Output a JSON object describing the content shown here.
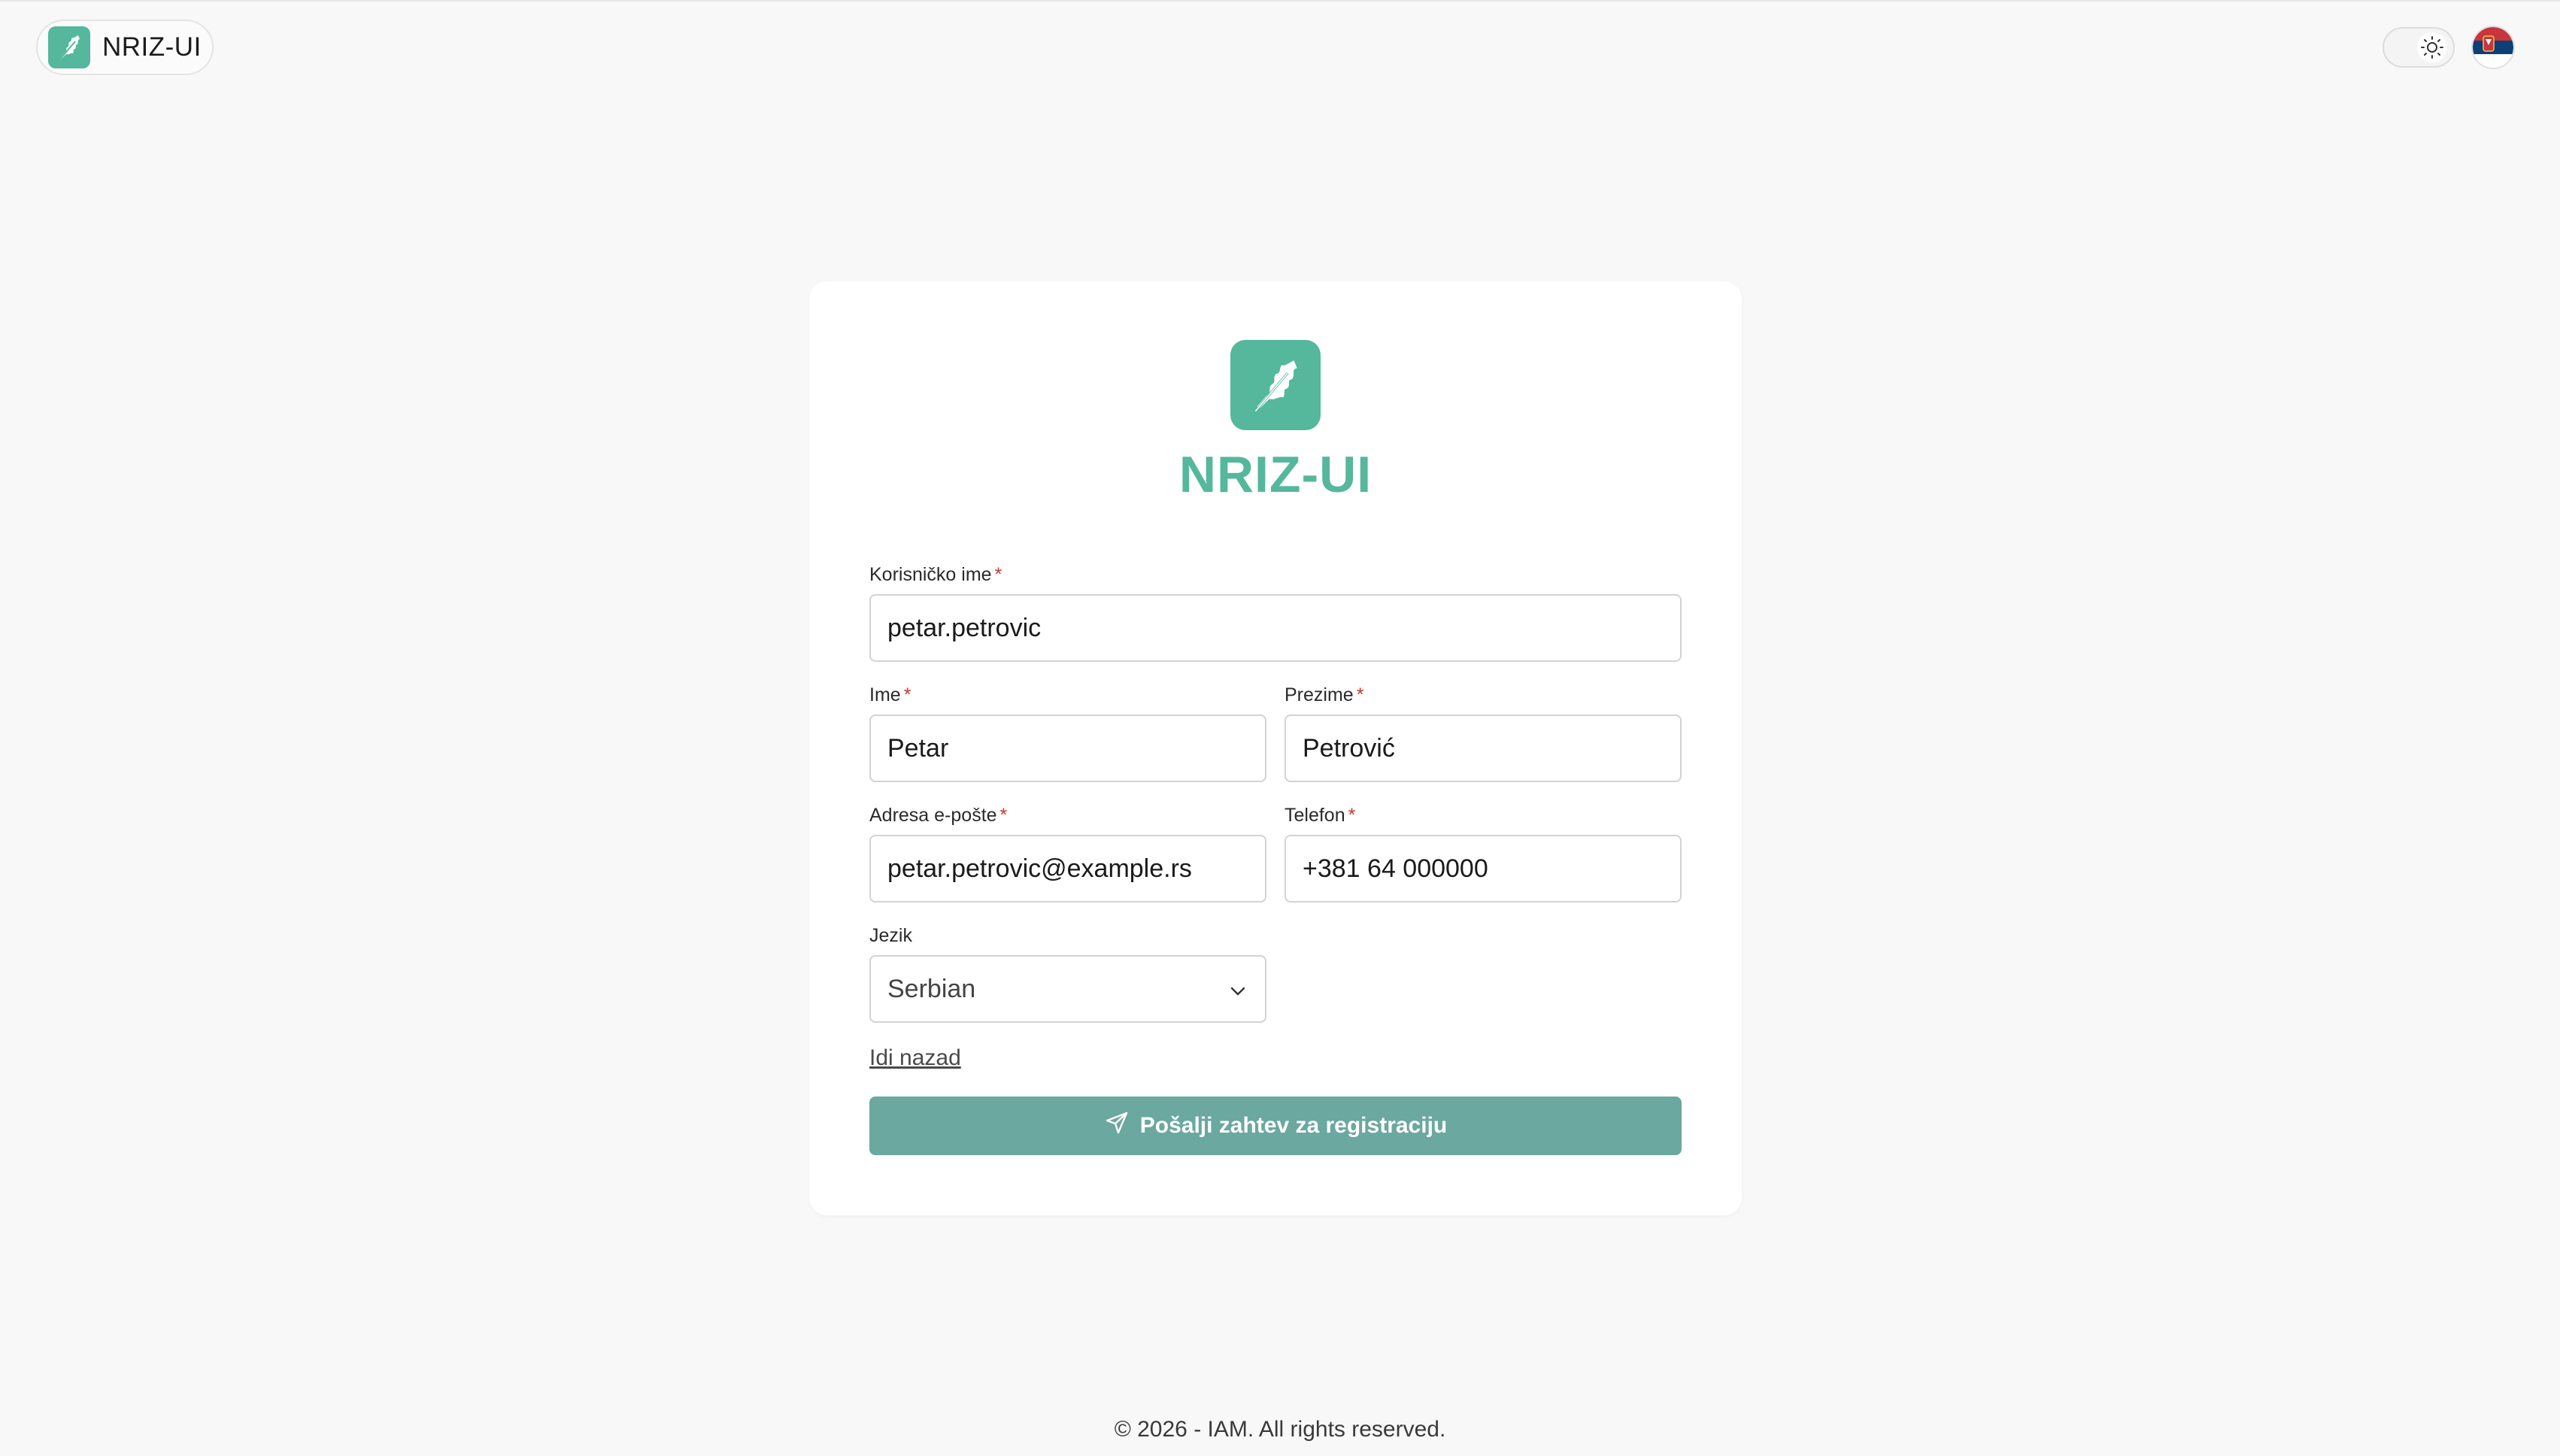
{
  "header": {
    "brand_text": "NRIZ-UI"
  },
  "card": {
    "title": "NRIZ-UI",
    "required_mark": "*",
    "username": {
      "label": "Korisničko ime",
      "value": "petar.petrovic"
    },
    "first_name": {
      "label": "Ime",
      "value": "Petar"
    },
    "last_name": {
      "label": "Prezime",
      "value": "Petrović"
    },
    "email": {
      "label": "Adresa e-pošte",
      "value": "petar.petrovic@example.rs"
    },
    "phone": {
      "label": "Telefon",
      "value": "+381 64 000000"
    },
    "language": {
      "label": "Jezik",
      "selected": "Serbian"
    },
    "back_link": "Idi nazad",
    "submit_label": "Pošalji zahtev za registraciju"
  },
  "footer": {
    "text": "© 2026 - IAM. All rights reserved."
  },
  "colors": {
    "brand": "#55b79c",
    "button": "#6aa8a0",
    "required": "#c0392b",
    "background": "#f8f8f8"
  },
  "icons": {
    "brand_logo": "oak-leaf-icon",
    "theme_toggle": "sun-icon",
    "language_flag": "serbia-flag-icon",
    "select_chevron": "chevron-down-icon",
    "submit_icon": "send-icon"
  }
}
